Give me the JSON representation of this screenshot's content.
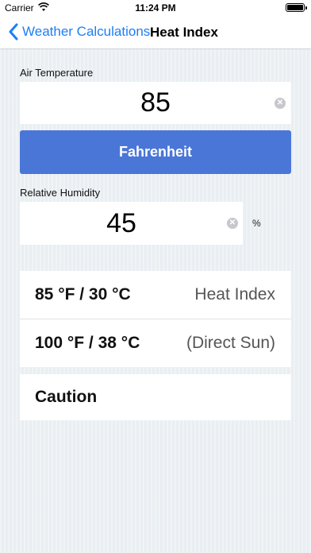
{
  "status_bar": {
    "carrier": "Carrier",
    "time": "11:24 PM"
  },
  "nav": {
    "back_label": "Weather Calculations",
    "title": "Heat Index"
  },
  "air_temperature": {
    "label": "Air Temperature",
    "value": "85"
  },
  "unit_button": {
    "label": "Fahrenheit"
  },
  "relative_humidity": {
    "label": "Relative Humidity",
    "value": "45",
    "unit": "%"
  },
  "results": {
    "rows": [
      {
        "value": "85 °F / 30 °C",
        "label": "Heat Index"
      },
      {
        "value": "100 °F / 38 °C",
        "label": "(Direct Sun)"
      }
    ]
  },
  "risk_level": "Caution",
  "colors": {
    "accent": "#1d7ef5",
    "button": "#4a76d8"
  }
}
